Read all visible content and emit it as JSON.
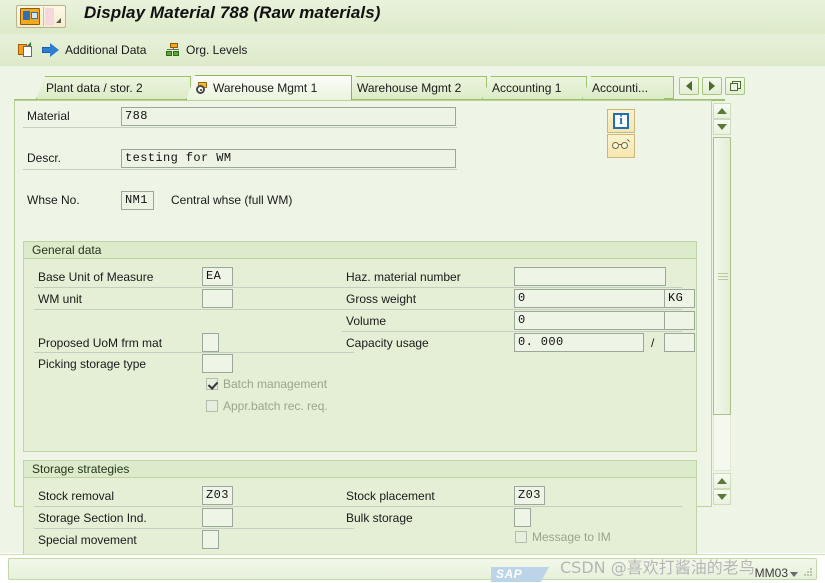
{
  "window": {
    "title": "Display Material 788 (Raw materials)",
    "system_icon": "sap-document-icon"
  },
  "toolbar": {
    "items": [
      {
        "label": "Additional Data",
        "icon": "copy-icon"
      },
      {
        "label": "Org. Levels",
        "icon": "org-levels-icon"
      }
    ]
  },
  "tabs": {
    "items": [
      {
        "label": "Plant data / stor. 2",
        "selected": false
      },
      {
        "label": "Warehouse Mgmt 1",
        "selected": true
      },
      {
        "label": "Warehouse Mgmt 2",
        "selected": false
      },
      {
        "label": "Accounting 1",
        "selected": false
      },
      {
        "label": "Accounti...",
        "selected": false
      }
    ],
    "nav": {
      "prev": "tab-scroll-left",
      "next": "tab-scroll-right",
      "list": "tab-list"
    }
  },
  "header": {
    "material": {
      "label": "Material",
      "value": "788"
    },
    "description": {
      "label": "Descr.",
      "value": "testing for WM"
    },
    "warehouse": {
      "label": "Whse No.",
      "value": "NM1",
      "text": "Central whse (full WM)"
    },
    "buttons": [
      {
        "name": "info-button",
        "icon": "info-icon"
      },
      {
        "name": "display-glasses-button",
        "icon": "glasses-icon"
      }
    ]
  },
  "general_data": {
    "caption": "General data",
    "left": [
      {
        "label": "Base Unit of Measure",
        "value": "EA"
      },
      {
        "label": "WM unit",
        "value": ""
      },
      {
        "label": "Proposed UoM frm mat",
        "value": ""
      },
      {
        "label": "Picking storage type",
        "value": ""
      }
    ],
    "right": [
      {
        "label": "Haz. material number",
        "value": ""
      },
      {
        "label": "Gross weight",
        "value": "0",
        "unit": "KG"
      },
      {
        "label": "Volume",
        "value": "0",
        "unit": ""
      },
      {
        "label": "Capacity usage",
        "value": "0. 000",
        "separator": "/",
        "unit": ""
      }
    ],
    "checkboxes": [
      {
        "label": "Batch management",
        "checked": true,
        "disabled": true
      },
      {
        "label": "Appr.batch rec. req.",
        "checked": false,
        "disabled": true
      }
    ]
  },
  "storage_strategies": {
    "caption": "Storage strategies",
    "left": [
      {
        "label": "Stock removal",
        "value": "Z03"
      },
      {
        "label": "Storage Section Ind.",
        "value": ""
      },
      {
        "label": "Special movement",
        "value": ""
      }
    ],
    "right": [
      {
        "label": "Stock placement",
        "value": "Z03"
      },
      {
        "label": "Bulk storage",
        "value": ""
      }
    ],
    "checkboxes": [
      {
        "label": "Message to IM",
        "checked": false,
        "disabled": true
      }
    ]
  },
  "status_bar": {
    "logo": "SAP",
    "transaction_code": "MM03"
  },
  "watermark": {
    "text": "CSDN @喜欢打酱油的老鸟"
  },
  "colors": {
    "title_bg": "#e4efd5",
    "panel_bg": "#eef5e6",
    "group_bg": "#e4efd5",
    "group_border": "#c0d3a6",
    "accent": "#9dc06c"
  }
}
